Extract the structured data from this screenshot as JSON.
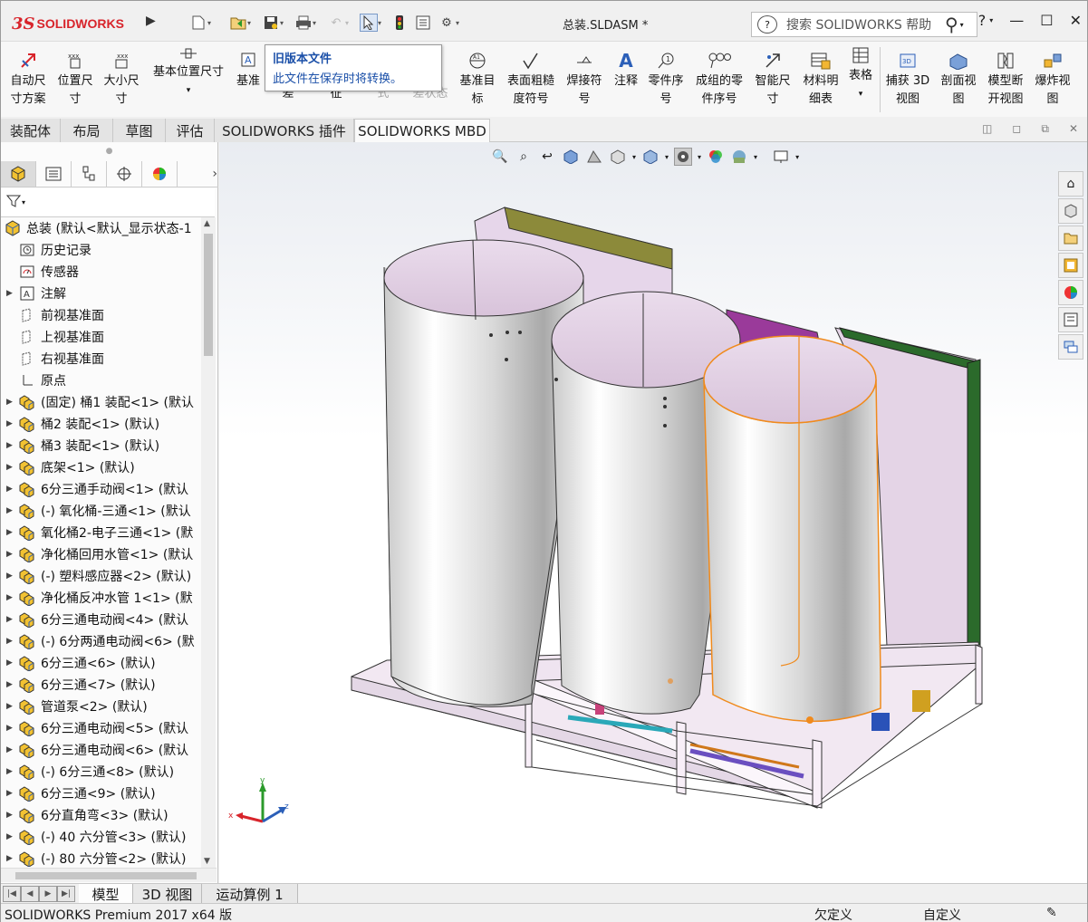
{
  "app": {
    "brand": "SOLIDWORKS",
    "doc_title": "总装.SLDASM *",
    "search_placeholder": "搜索 SOLIDWORKS 帮助"
  },
  "ribbon": {
    "items": [
      {
        "label1": "自动尺",
        "label2": "寸方案"
      },
      {
        "label1": "位置尺",
        "label2": "寸"
      },
      {
        "label1": "大小尺",
        "label2": "寸"
      },
      {
        "label1": "基本位置尺寸",
        "label2": ""
      },
      {
        "label1": "基准",
        "label2": ""
      },
      {
        "label1": "",
        "label2": "差"
      },
      {
        "label1": "",
        "label2": "征"
      },
      {
        "label1": "",
        "label2": "式"
      },
      {
        "label1": "",
        "label2": "差状态"
      },
      {
        "label1": "基准目",
        "label2": "标"
      },
      {
        "label1": "表面粗糙",
        "label2": "度符号"
      },
      {
        "label1": "焊接符",
        "label2": "号"
      },
      {
        "label1": "注释",
        "label2": ""
      },
      {
        "label1": "零件序",
        "label2": "号"
      },
      {
        "label1": "成组的零",
        "label2": "件序号"
      },
      {
        "label1": "智能尺",
        "label2": "寸"
      },
      {
        "label1": "材料明",
        "label2": "细表"
      },
      {
        "label1": "表格",
        "label2": ""
      },
      {
        "label1": "捕获 3D",
        "label2": "视图"
      },
      {
        "label1": "剖面视",
        "label2": "图"
      },
      {
        "label1": "模型断",
        "label2": "开视图"
      },
      {
        "label1": "爆炸视",
        "label2": "图"
      }
    ]
  },
  "tooltip": {
    "title": "旧版本文件",
    "body": "此文件在保存时将转换。"
  },
  "tabs": [
    "装配体",
    "布局",
    "草图",
    "评估",
    "SOLIDWORKS 插件",
    "SOLIDWORKS MBD"
  ],
  "active_tab": "SOLIDWORKS MBD",
  "tree": {
    "root": "总装 (默认<默认_显示状态-1",
    "items": [
      {
        "label": "历史记录",
        "expandable": false,
        "icon": "history-icon"
      },
      {
        "label": "传感器",
        "expandable": false,
        "icon": "sensor-icon"
      },
      {
        "label": "注解",
        "expandable": true,
        "icon": "annotation-icon"
      },
      {
        "label": "前视基准面",
        "expandable": false,
        "icon": "plane-icon"
      },
      {
        "label": "上视基准面",
        "expandable": false,
        "icon": "plane-icon"
      },
      {
        "label": "右视基准面",
        "expandable": false,
        "icon": "plane-icon"
      },
      {
        "label": "原点",
        "expandable": false,
        "icon": "origin-icon"
      },
      {
        "label": "(固定) 桶1 装配<1> (默认",
        "expandable": true,
        "icon": "subassembly-icon"
      },
      {
        "label": "桶2 装配<1> (默认)",
        "expandable": true,
        "icon": "subassembly-icon"
      },
      {
        "label": "桶3 装配<1> (默认)",
        "expandable": true,
        "icon": "subassembly-icon"
      },
      {
        "label": "底架<1> (默认)",
        "expandable": true,
        "icon": "subassembly-icon"
      },
      {
        "label": "6分三通手动阀<1> (默认",
        "expandable": true,
        "icon": "subassembly-icon"
      },
      {
        "label": "(-) 氧化桶-三通<1> (默认",
        "expandable": true,
        "icon": "subassembly-icon"
      },
      {
        "label": "氧化桶2-电子三通<1> (默",
        "expandable": true,
        "icon": "subassembly-icon"
      },
      {
        "label": "净化桶回用水管<1> (默认",
        "expandable": true,
        "icon": "subassembly-icon"
      },
      {
        "label": "(-) 塑料感应器<2> (默认)",
        "expandable": true,
        "icon": "subassembly-icon"
      },
      {
        "label": "净化桶反冲水管 1<1> (默",
        "expandable": true,
        "icon": "subassembly-icon"
      },
      {
        "label": "6分三通电动阀<4> (默认",
        "expandable": true,
        "icon": "subassembly-icon"
      },
      {
        "label": "(-) 6分两通电动阀<6> (默",
        "expandable": true,
        "icon": "subassembly-icon"
      },
      {
        "label": "6分三通<6> (默认)",
        "expandable": true,
        "icon": "subassembly-icon"
      },
      {
        "label": "6分三通<7> (默认)",
        "expandable": true,
        "icon": "subassembly-icon"
      },
      {
        "label": "管道泵<2> (默认)",
        "expandable": true,
        "icon": "subassembly-icon"
      },
      {
        "label": "6分三通电动阀<5> (默认",
        "expandable": true,
        "icon": "subassembly-icon"
      },
      {
        "label": "6分三通电动阀<6> (默认",
        "expandable": true,
        "icon": "subassembly-icon"
      },
      {
        "label": "(-) 6分三通<8> (默认)",
        "expandable": true,
        "icon": "subassembly-icon"
      },
      {
        "label": "6分三通<9> (默认)",
        "expandable": true,
        "icon": "subassembly-icon"
      },
      {
        "label": "6分直角弯<3> (默认)",
        "expandable": true,
        "icon": "subassembly-icon"
      },
      {
        "label": "(-) 40  六分管<3> (默认)",
        "expandable": true,
        "icon": "subassembly-icon"
      },
      {
        "label": "(-) 80 六分管<2> (默认)",
        "expandable": true,
        "icon": "subassembly-icon"
      }
    ]
  },
  "bottom_tabs": [
    "模型",
    "3D 视图",
    "运动算例 1"
  ],
  "status": {
    "product": "SOLIDWORKS Premium 2017 x64 版",
    "state1": "欠定义",
    "state2": "自定义"
  },
  "triad": {
    "x": "x",
    "y": "y",
    "z": "z"
  },
  "colors": {
    "brand_red": "#d8242b",
    "tooltip_blue": "#1a4fa8",
    "selection_orange": "#f08a1c"
  }
}
